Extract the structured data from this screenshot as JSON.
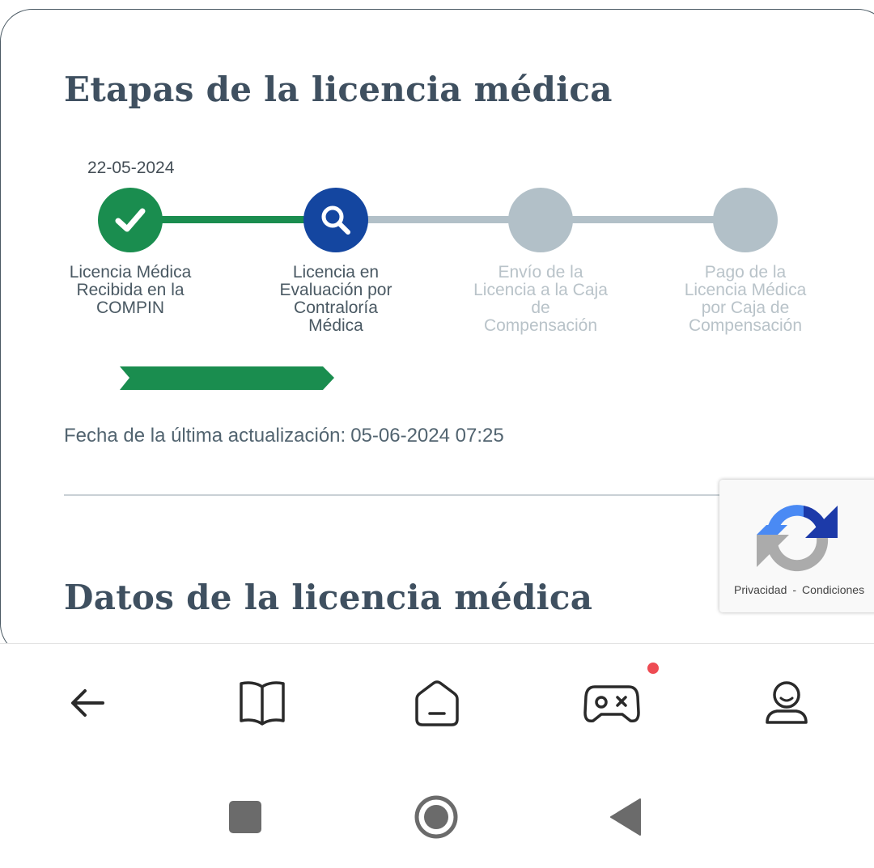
{
  "stages_section": {
    "title": "Etapas de la licencia médica",
    "first_date": "22-05-2024",
    "steps": [
      {
        "label_lines": [
          "Licencia Médica",
          "Recibida en la",
          "COMPIN"
        ],
        "status": "done",
        "icon": "check-icon"
      },
      {
        "label_lines": [
          "Licencia en",
          "Evaluación por",
          "Contraloría",
          "Médica"
        ],
        "status": "current",
        "icon": "search-icon"
      },
      {
        "label_lines": [
          "Envío de la",
          "Licencia a la Caja",
          "de",
          "Compensación"
        ],
        "status": "pending",
        "icon": ""
      },
      {
        "label_lines": [
          "Pago de la",
          "Licencia Médica",
          "por Caja de",
          "Compensación"
        ],
        "status": "pending",
        "icon": ""
      }
    ],
    "last_update_label": "Fecha de la última actualización:",
    "last_update_value": "05-06-2024 07:25"
  },
  "data_section": {
    "title": "Datos de la licencia médica"
  },
  "recaptcha": {
    "privacy": "Privacidad",
    "separator": "-",
    "terms": "Condiciones"
  },
  "bottom_nav": {
    "items": [
      "back-arrow-icon",
      "book-icon",
      "home-icon",
      "gamepad-icon",
      "profile-icon"
    ],
    "games_has_notification": true
  },
  "system_nav": {
    "items": [
      "recents-square-icon",
      "home-circle-icon",
      "back-triangle-icon"
    ]
  },
  "colors": {
    "done": "#1a8d4f",
    "current": "#1446a0",
    "pending": "#b2c0c8",
    "text_dark": "#3f5060",
    "notification": "#ee4b53"
  }
}
